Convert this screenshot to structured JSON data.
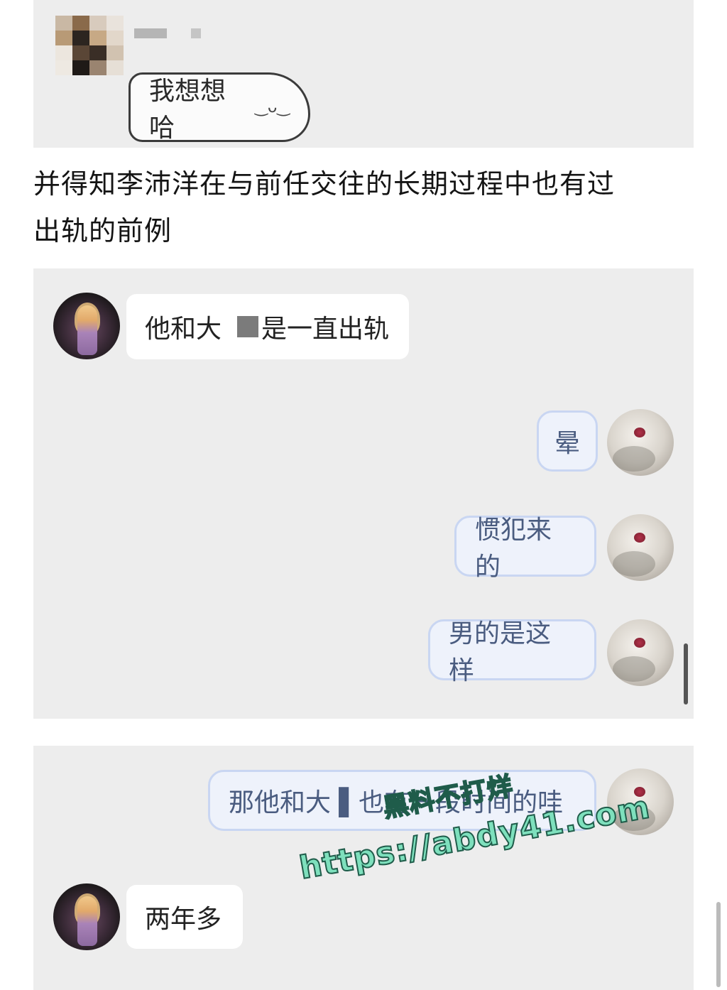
{
  "top_chat": {
    "message": "我想想哈"
  },
  "caption": {
    "line1": "并得知李沛洋在与前任交往的长期过程中也有过",
    "line2": "出轨的前例"
  },
  "chat1": {
    "messages": [
      {
        "side": "left",
        "text_a": "他和大",
        "text_b": "是一直出轨"
      },
      {
        "side": "right",
        "text": "晕"
      },
      {
        "side": "right",
        "text": "惯犯来的"
      },
      {
        "side": "right",
        "text": "男的是这样"
      }
    ]
  },
  "chat2": {
    "messages": [
      {
        "side": "right",
        "text": "那他和大 ▌也有一段时间的哇"
      },
      {
        "side": "left",
        "text": "两年多"
      }
    ]
  },
  "watermark": {
    "line1": "黑料不打烊",
    "line2": "https://abdy41.com"
  },
  "colors": {
    "panel_bg": "#ededed",
    "bubble_white": "#ffffff",
    "bubble_cute": "#eef2fb",
    "watermark": "#7ee0bd"
  }
}
